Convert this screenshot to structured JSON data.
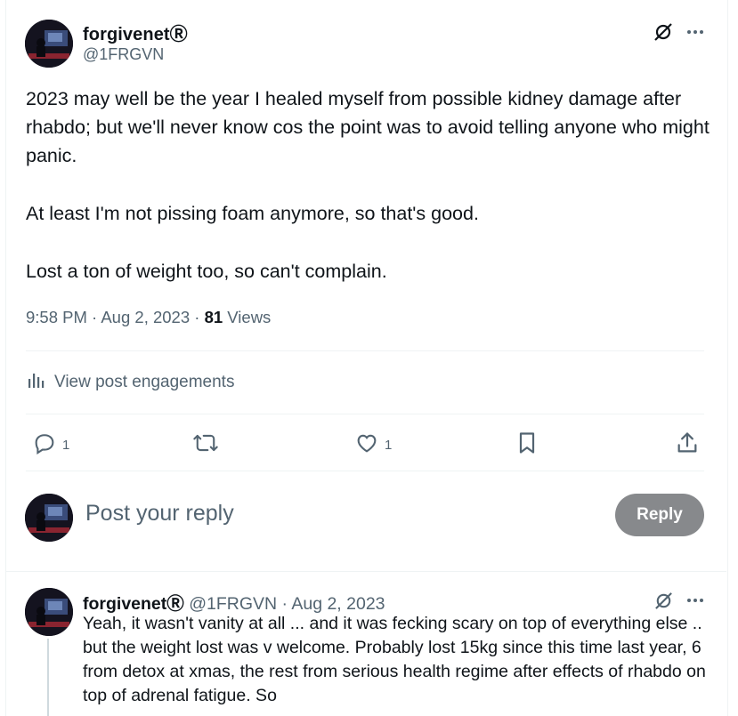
{
  "post": {
    "author": {
      "name": "forgivenetⓇ",
      "handle": "@1FRGVN"
    },
    "paragraphs": [
      "2023 may well be the year I healed myself from possible kidney damage after rhabdo; but we'll never know cos the point was to avoid telling anyone who might panic.",
      "At least I'm not pissing foam anymore, so that's good.",
      "Lost a ton of weight too, so can't complain."
    ],
    "time": "9:58 PM",
    "date": "Aug 2, 2023",
    "separator": "·",
    "views_count": "81",
    "views_label": "Views",
    "engagements_label": "View post engagements",
    "actions": {
      "replies": "1",
      "likes": "1"
    }
  },
  "composer": {
    "placeholder": "Post your reply",
    "button_label": "Reply"
  },
  "reply": {
    "name": "forgivenetⓇ",
    "handle": "@1FRGVN",
    "meta_separator": "·",
    "date": "Aug 2, 2023",
    "text": "Yeah, it wasn't vanity at all ... and it was fecking scary on top of everything else .. but the weight lost was v welcome. Probably lost 15kg since this time last year, 6 from detox at xmas, the rest from serious health regime after effects of rhabdo on top of adrenal fatigue. So"
  },
  "icons": {
    "grok": "grok-icon",
    "more": "more-icon",
    "analytics": "analytics-icon",
    "reply": "reply-icon",
    "repost": "repost-icon",
    "like": "like-icon",
    "bookmark": "bookmark-icon",
    "share": "share-icon"
  },
  "colors": {
    "text": "#0f1419",
    "muted": "#536471",
    "reply_button": "#87898c",
    "divider": "#eff3f4"
  }
}
